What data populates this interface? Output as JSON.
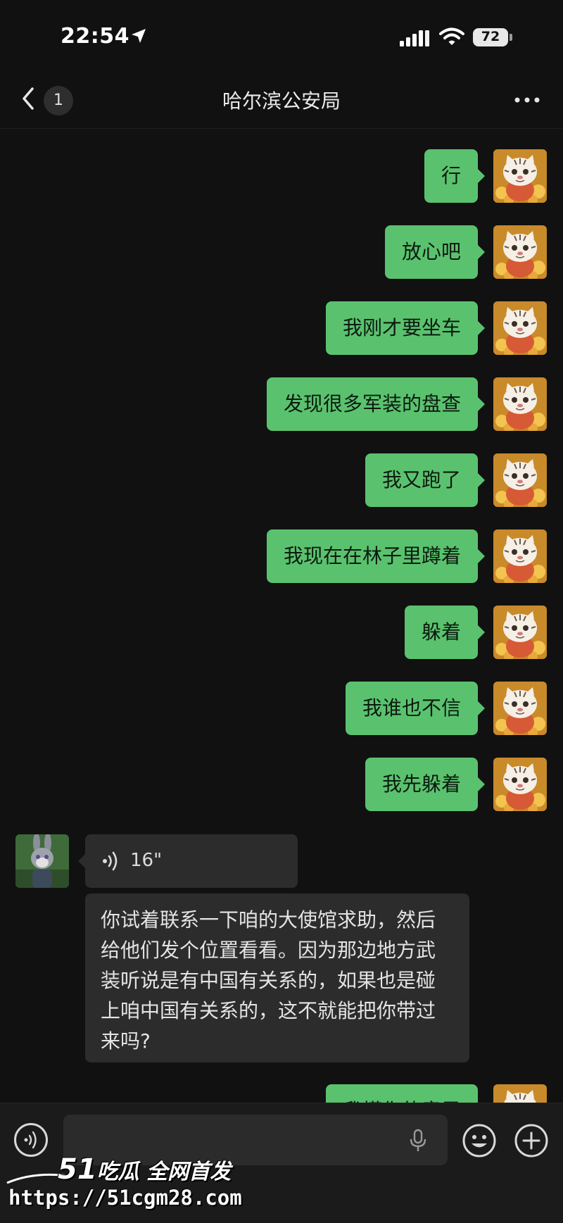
{
  "status_bar": {
    "time": "22:54",
    "battery": "72"
  },
  "nav": {
    "unread_count": "1",
    "title": "哈尔滨公安局"
  },
  "messages_out": [
    {
      "text": "行"
    },
    {
      "text": "放心吧"
    },
    {
      "text": "我刚才要坐车"
    },
    {
      "text": "发现很多军装的盘查"
    },
    {
      "text": "我又跑了"
    },
    {
      "text": "我现在在林子里蹲着"
    },
    {
      "text": "躲着"
    },
    {
      "text": "我谁也不信"
    },
    {
      "text": "我先躲着"
    }
  ],
  "messages_in": {
    "voice_duration": "16\"",
    "text": "你试着联系一下咱的大使馆求助，然后给他们发个位置看看。因为那边地方武装听说是有中国有关系的，如果也是碰上咱中国有关系的，这不就能把你带过来吗?"
  },
  "partial_message": {
    "text": "我懂你的意思"
  },
  "watermark": {
    "brand_number": "51",
    "brand_text": "吃瓜 全网首发",
    "url": "https://51cgm28.com"
  },
  "colors": {
    "outgoing_bubble": "#5ac26e",
    "incoming_bubble": "#2c2c2c",
    "background": "#111111"
  }
}
